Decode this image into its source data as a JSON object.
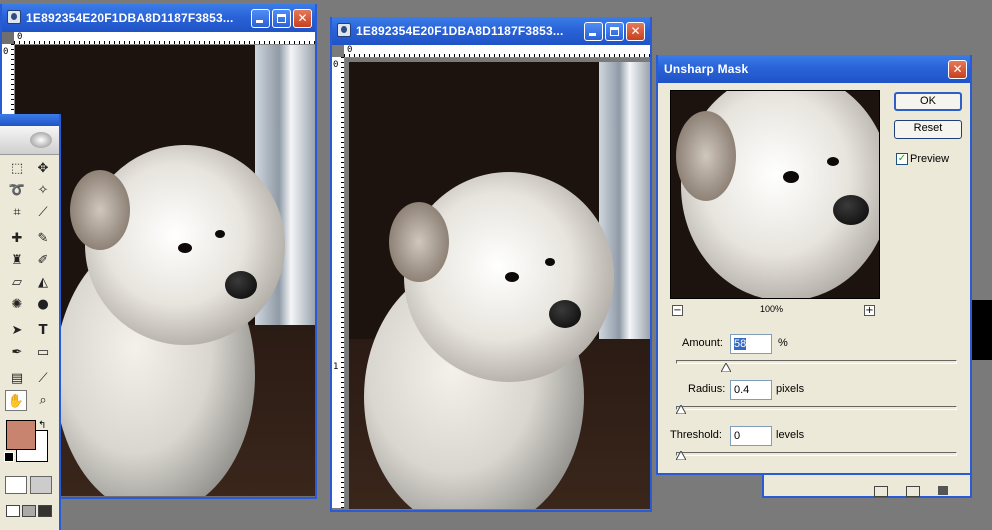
{
  "windows": [
    {
      "title": "1E892354E20F1DBA8D1187F3853...",
      "ruler_h_zero": "0",
      "ruler_v_zero": "0"
    },
    {
      "title": "1E892354E20F1DBA8D1187F3853...",
      "ruler_h_zero": "0",
      "ruler_v_zero": "0",
      "ruler_v_one": "1"
    }
  ],
  "dialog": {
    "title": "Unsharp Mask",
    "ok_label": "OK",
    "reset_label": "Reset",
    "preview_label": "Preview",
    "preview_checked": true,
    "zoom_level": "100%",
    "zoom_out_label": "−",
    "zoom_in_label": "+",
    "amount": {
      "label": "Amount:",
      "value": "58",
      "unit": "%",
      "fraction": 0.16
    },
    "radius": {
      "label": "Radius:",
      "value": "0.4",
      "unit": "pixels",
      "fraction": 0.0
    },
    "threshold": {
      "label": "Threshold:",
      "value": "0",
      "unit": "levels",
      "fraction": 0.0
    }
  },
  "toolbox": {
    "tools": [
      "marquee-icon",
      "move-icon",
      "lasso-icon",
      "magic-wand-icon",
      "crop-icon",
      "slice-icon",
      "healing-icon",
      "brush-icon",
      "stamp-icon",
      "history-brush-icon",
      "eraser-icon",
      "bucket-icon",
      "blur-icon",
      "dodge-icon",
      "path-select-icon",
      "type-icon",
      "pen-icon",
      "shape-icon",
      "notes-icon",
      "eyedropper-icon",
      "hand-icon",
      "zoom-icon"
    ],
    "foreground_color": "#c8846f",
    "background_color": "#ffffff"
  },
  "colors": {
    "desktop": "#7a7a7a",
    "titlebar": "#2a63d8",
    "dialog_bg": "#ece9d8"
  }
}
